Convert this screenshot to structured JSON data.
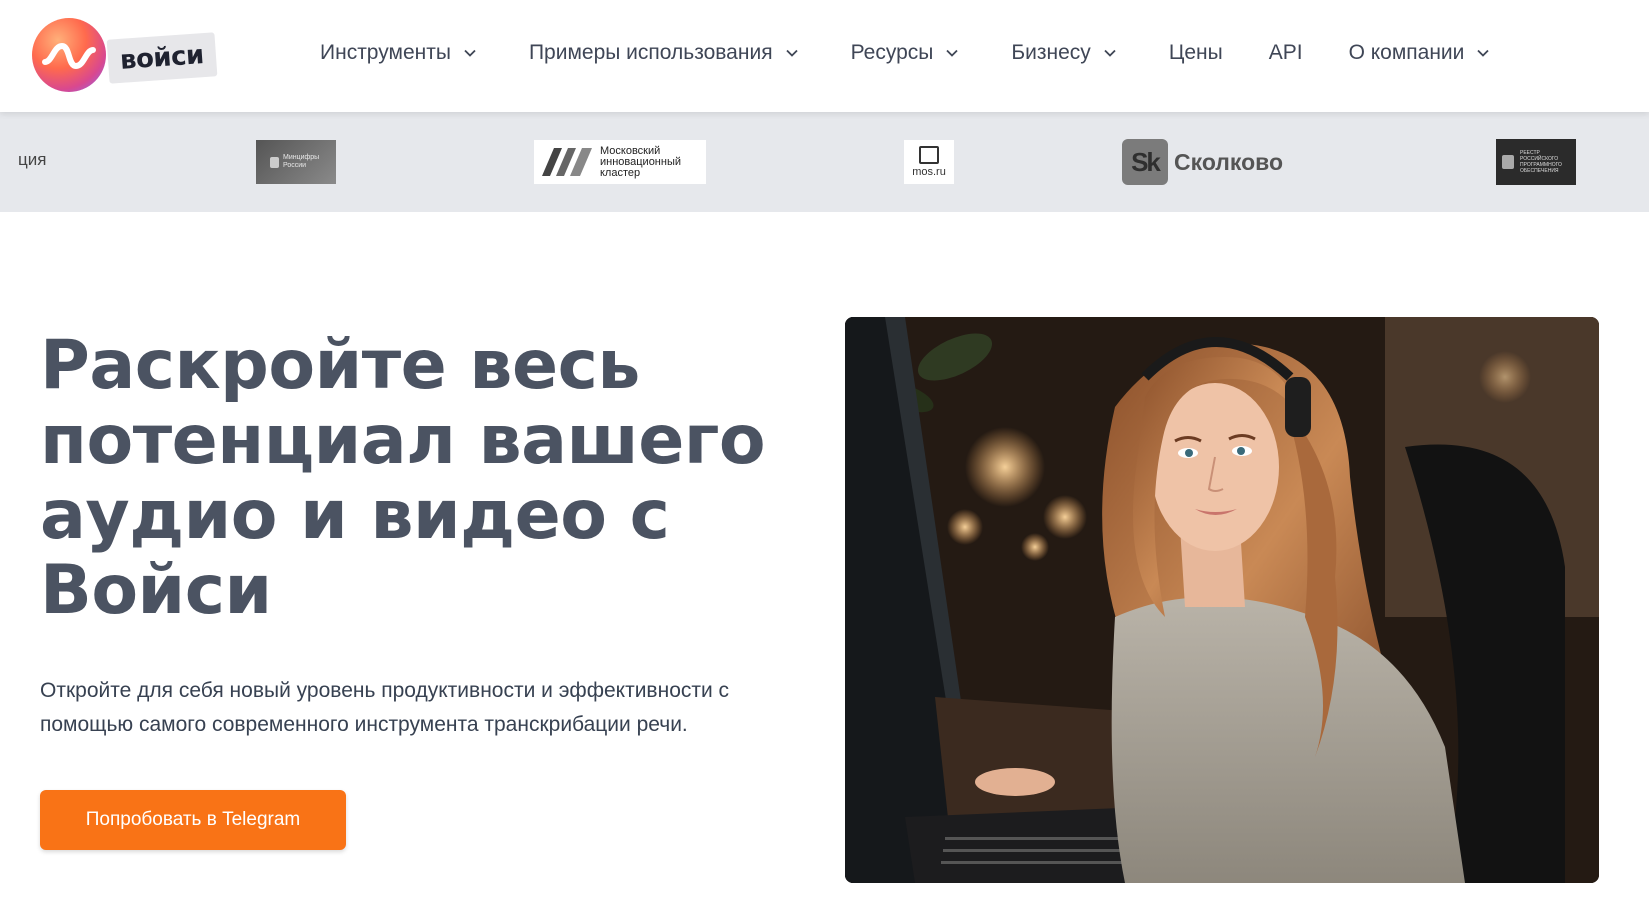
{
  "brand": {
    "name": "войси",
    "logo_colors": [
      "#ff6a4d",
      "#d9488f",
      "#7f6cff"
    ]
  },
  "nav": {
    "items": [
      {
        "label": "Инструменты",
        "dropdown": true
      },
      {
        "label": "Примеры использования",
        "dropdown": true
      },
      {
        "label": "Ресурсы",
        "dropdown": true
      },
      {
        "label": "Бизнесу",
        "dropdown": true
      },
      {
        "label": "Цены",
        "dropdown": false
      },
      {
        "label": "API",
        "dropdown": false
      },
      {
        "label": "О компании",
        "dropdown": true
      }
    ]
  },
  "partners": {
    "cut_text": "ция",
    "mincifry": "Минцифры России",
    "mik": "Московский инновационный кластер",
    "mos": "mos.ru",
    "skolkovo_mark": "Sk",
    "skolkovo": "Сколково",
    "reestr": "РЕЕСТР РОССИЙСКОГО ПРОГРАММНОГО ОБЕСПЕЧЕНИЯ"
  },
  "hero": {
    "title": "Раскройте весь потенциал вашего аудио и видео с Войси",
    "subtitle": "Откройте для себя новый уровень продуктивности и эффективности с помощью самого современного инструмента транскрибации речи.",
    "cta_label": "Попробовать в Telegram",
    "accent_color": "#f97316"
  }
}
